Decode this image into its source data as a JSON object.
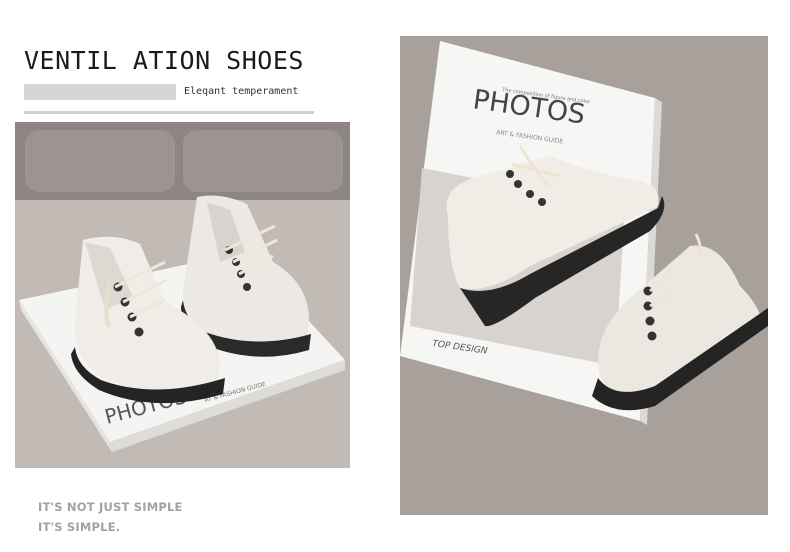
{
  "header": {
    "title": "VENTIL ATION SHOES",
    "subtitle": "Eleqant temperament"
  },
  "photos": {
    "left": {
      "book_title": "PHOTOS",
      "book_subtitle": "AT & FASHION GUIDE"
    },
    "right": {
      "book_tagline": "The composition of figure and color",
      "book_title": "PHOTOS",
      "book_subtitle": "ART & FASHION GUIDE",
      "book_footer": "TOP DESIGN"
    }
  },
  "slogan": {
    "line1": "IT'S NOT JUST SIMPLE",
    "line2": "IT'S SIMPLE."
  }
}
